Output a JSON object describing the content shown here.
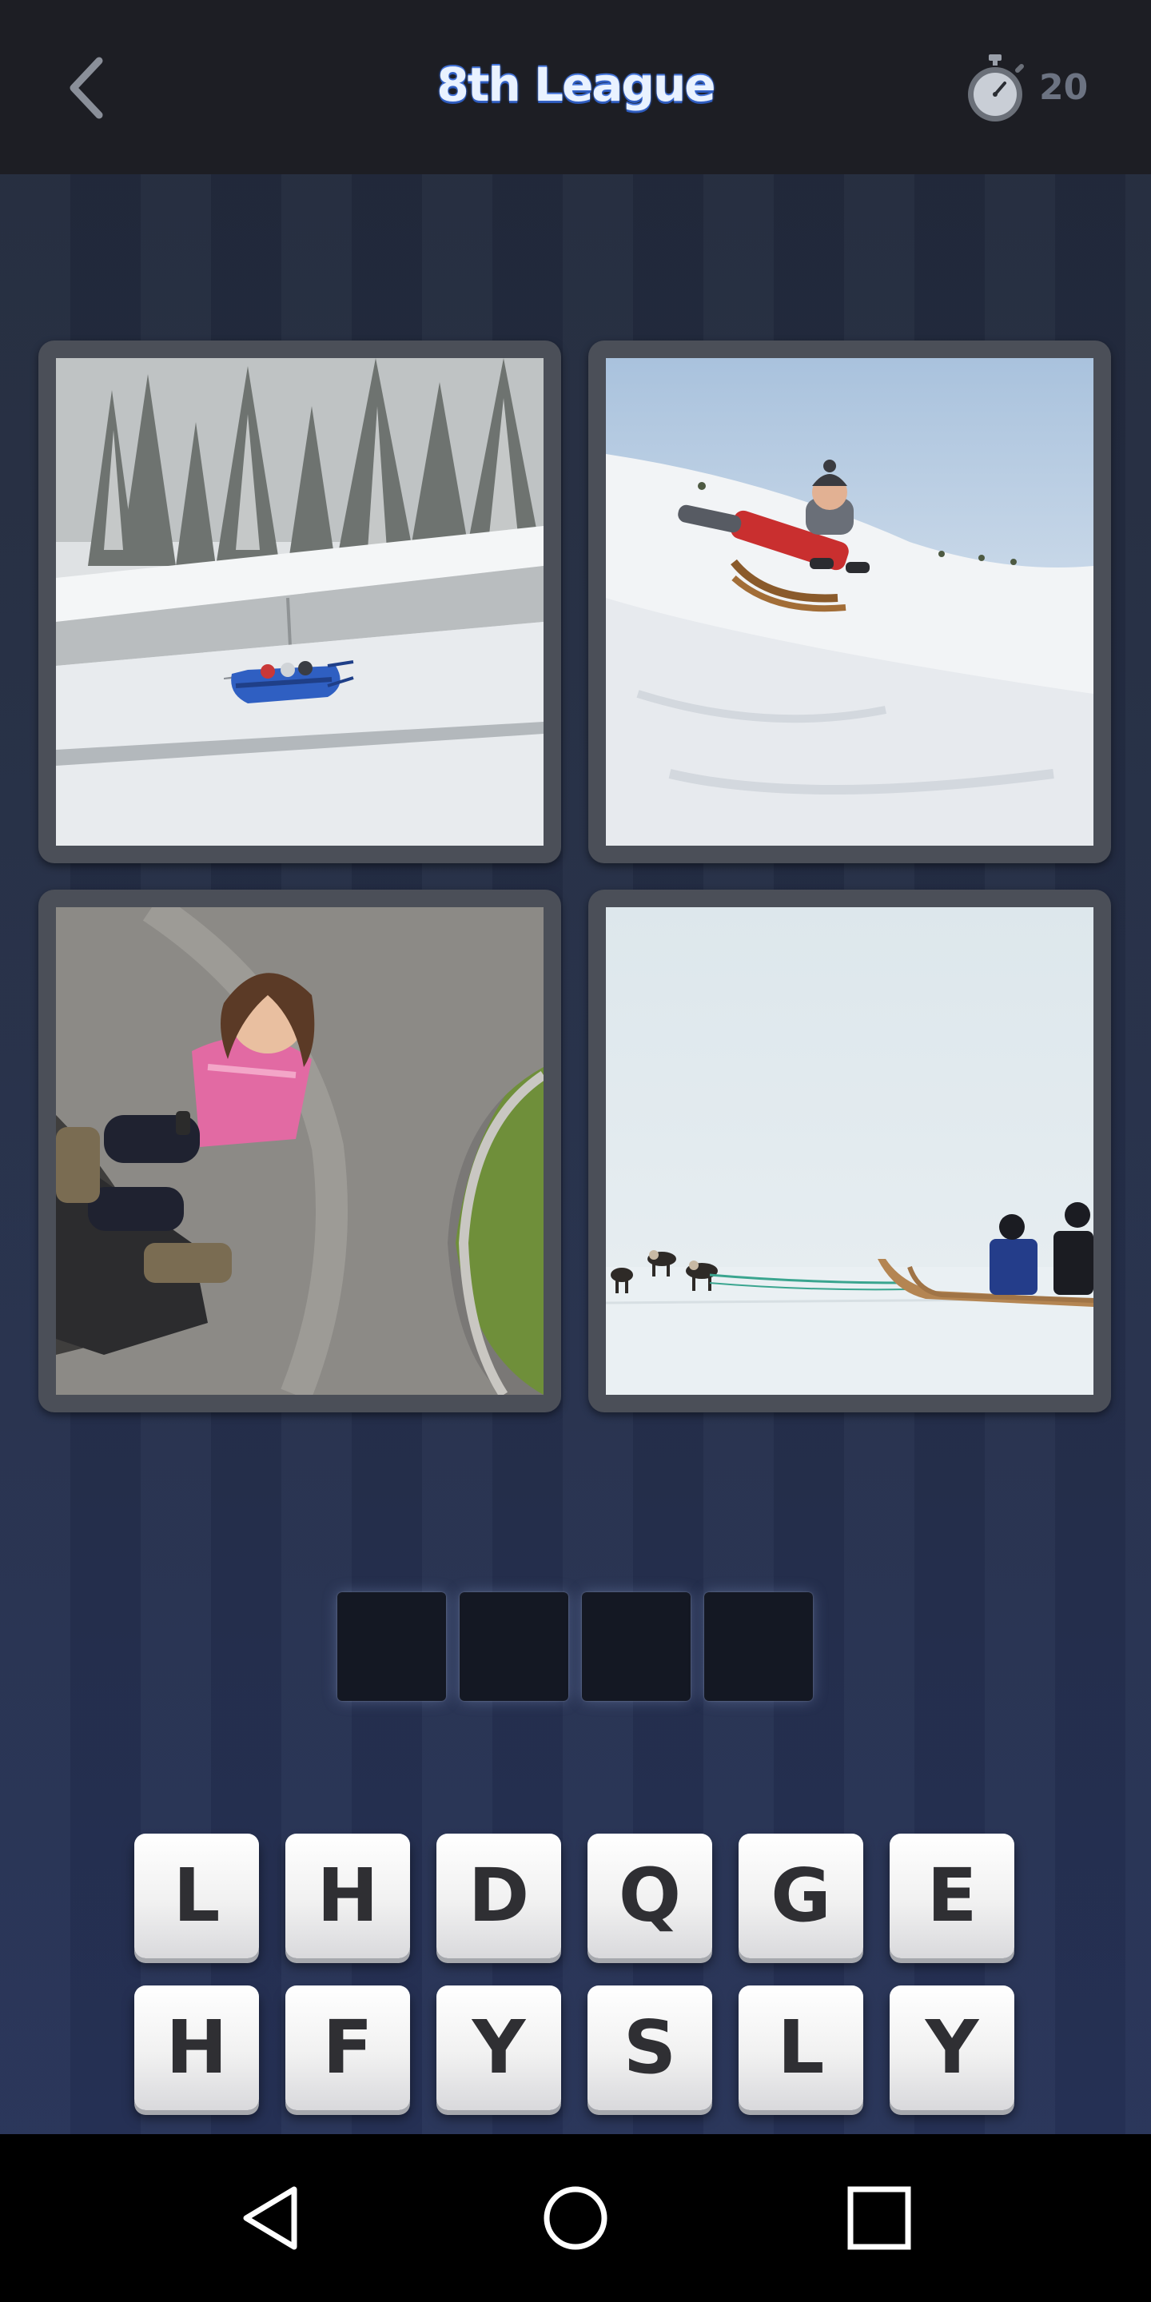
{
  "header": {
    "back_icon": "chevron-left-icon",
    "title": "8th League",
    "timer_icon": "stopwatch-icon",
    "timer_value": "20"
  },
  "puzzle": {
    "images": [
      {
        "subject": "bobsleigh"
      },
      {
        "subject": "boy-sledding"
      },
      {
        "subject": "girl-on-alpine-slide"
      },
      {
        "subject": "dog-sled"
      }
    ],
    "answer_slots": [
      "",
      "",
      "",
      ""
    ]
  },
  "letters": {
    "row1": [
      "L",
      "H",
      "D",
      "Q",
      "G",
      "E"
    ],
    "row2": [
      "H",
      "F",
      "Y",
      "S",
      "L",
      "Y"
    ]
  },
  "navigation": {
    "back": "triangle-back-icon",
    "home": "circle-home-icon",
    "recents": "square-recents-icon"
  },
  "colors": {
    "topbar": "#1d1e24",
    "background": "#242e47",
    "title": "#e9f2ff",
    "title_outline": "#3f6fd6",
    "slot": "#141823",
    "key_text": "#2f2f33"
  }
}
